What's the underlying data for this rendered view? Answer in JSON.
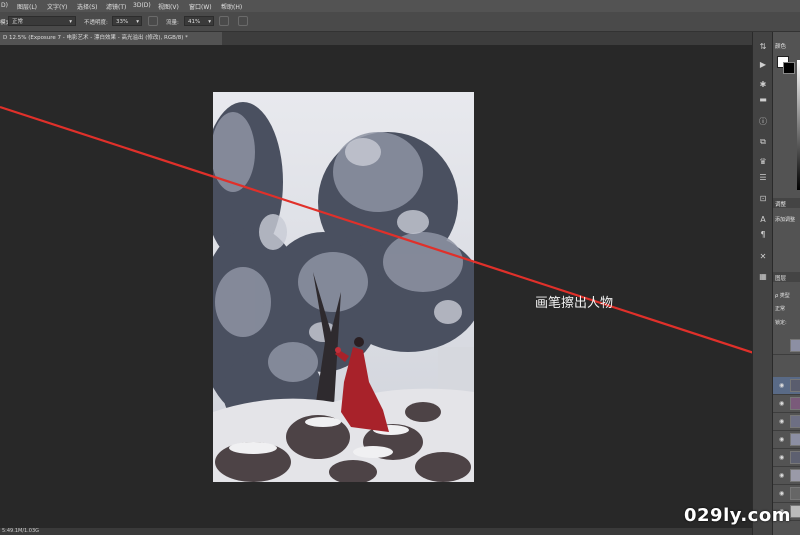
{
  "menu": {
    "items": [
      "D)",
      "图层(L)",
      "文字(Y)",
      "选择(S)",
      "滤镜(T)",
      "3D(D)",
      "视图(V)",
      "窗口(W)",
      "帮助(H)"
    ]
  },
  "options": {
    "mode_label": "模式:",
    "mode_value": "正常",
    "opacity_label": "不透明度:",
    "opacity_value": "33%",
    "flow_label": "流量:",
    "flow_value": "41%"
  },
  "document_tab": {
    "label": "D 12.5% (Exposure 7 - 电影艺术 - 漂白效果 - 高光溢出 (修改), RGB/8) *",
    "close": "×"
  },
  "status": {
    "text": "5:49.1M/1.03G"
  },
  "annotation": {
    "caption": "画笔擦出人物",
    "line_color": "#e0302a"
  },
  "panels": {
    "color_tab": "颜色",
    "adjust_tab": "调整",
    "adjust_hint": "添加调整",
    "layers_tab": "图层",
    "filter_label": "ρ 类型",
    "blend_mode": "正常",
    "lock_label": "锁定:"
  },
  "watermark": {
    "text": "029ly.com"
  },
  "colors": {
    "ui_dark": "#282828",
    "ui_panel": "#535353",
    "dress_red": "#a8222a"
  }
}
